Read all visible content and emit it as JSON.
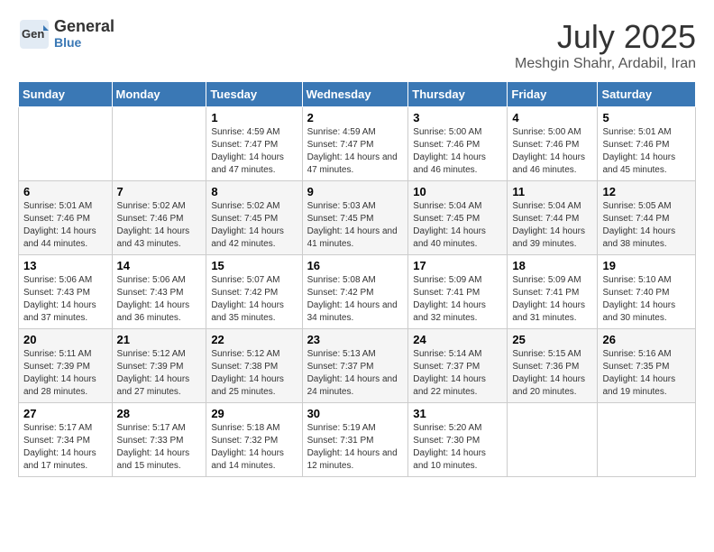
{
  "logo": {
    "general": "General",
    "blue": "Blue"
  },
  "title": {
    "month_year": "July 2025",
    "location": "Meshgin Shahr, Ardabil, Iran"
  },
  "headers": [
    "Sunday",
    "Monday",
    "Tuesday",
    "Wednesday",
    "Thursday",
    "Friday",
    "Saturday"
  ],
  "weeks": [
    [
      {
        "day": "",
        "sunrise": "",
        "sunset": "",
        "daylight": ""
      },
      {
        "day": "",
        "sunrise": "",
        "sunset": "",
        "daylight": ""
      },
      {
        "day": "1",
        "sunrise": "Sunrise: 4:59 AM",
        "sunset": "Sunset: 7:47 PM",
        "daylight": "Daylight: 14 hours and 47 minutes."
      },
      {
        "day": "2",
        "sunrise": "Sunrise: 4:59 AM",
        "sunset": "Sunset: 7:47 PM",
        "daylight": "Daylight: 14 hours and 47 minutes."
      },
      {
        "day": "3",
        "sunrise": "Sunrise: 5:00 AM",
        "sunset": "Sunset: 7:46 PM",
        "daylight": "Daylight: 14 hours and 46 minutes."
      },
      {
        "day": "4",
        "sunrise": "Sunrise: 5:00 AM",
        "sunset": "Sunset: 7:46 PM",
        "daylight": "Daylight: 14 hours and 46 minutes."
      },
      {
        "day": "5",
        "sunrise": "Sunrise: 5:01 AM",
        "sunset": "Sunset: 7:46 PM",
        "daylight": "Daylight: 14 hours and 45 minutes."
      }
    ],
    [
      {
        "day": "6",
        "sunrise": "Sunrise: 5:01 AM",
        "sunset": "Sunset: 7:46 PM",
        "daylight": "Daylight: 14 hours and 44 minutes."
      },
      {
        "day": "7",
        "sunrise": "Sunrise: 5:02 AM",
        "sunset": "Sunset: 7:46 PM",
        "daylight": "Daylight: 14 hours and 43 minutes."
      },
      {
        "day": "8",
        "sunrise": "Sunrise: 5:02 AM",
        "sunset": "Sunset: 7:45 PM",
        "daylight": "Daylight: 14 hours and 42 minutes."
      },
      {
        "day": "9",
        "sunrise": "Sunrise: 5:03 AM",
        "sunset": "Sunset: 7:45 PM",
        "daylight": "Daylight: 14 hours and 41 minutes."
      },
      {
        "day": "10",
        "sunrise": "Sunrise: 5:04 AM",
        "sunset": "Sunset: 7:45 PM",
        "daylight": "Daylight: 14 hours and 40 minutes."
      },
      {
        "day": "11",
        "sunrise": "Sunrise: 5:04 AM",
        "sunset": "Sunset: 7:44 PM",
        "daylight": "Daylight: 14 hours and 39 minutes."
      },
      {
        "day": "12",
        "sunrise": "Sunrise: 5:05 AM",
        "sunset": "Sunset: 7:44 PM",
        "daylight": "Daylight: 14 hours and 38 minutes."
      }
    ],
    [
      {
        "day": "13",
        "sunrise": "Sunrise: 5:06 AM",
        "sunset": "Sunset: 7:43 PM",
        "daylight": "Daylight: 14 hours and 37 minutes."
      },
      {
        "day": "14",
        "sunrise": "Sunrise: 5:06 AM",
        "sunset": "Sunset: 7:43 PM",
        "daylight": "Daylight: 14 hours and 36 minutes."
      },
      {
        "day": "15",
        "sunrise": "Sunrise: 5:07 AM",
        "sunset": "Sunset: 7:42 PM",
        "daylight": "Daylight: 14 hours and 35 minutes."
      },
      {
        "day": "16",
        "sunrise": "Sunrise: 5:08 AM",
        "sunset": "Sunset: 7:42 PM",
        "daylight": "Daylight: 14 hours and 34 minutes."
      },
      {
        "day": "17",
        "sunrise": "Sunrise: 5:09 AM",
        "sunset": "Sunset: 7:41 PM",
        "daylight": "Daylight: 14 hours and 32 minutes."
      },
      {
        "day": "18",
        "sunrise": "Sunrise: 5:09 AM",
        "sunset": "Sunset: 7:41 PM",
        "daylight": "Daylight: 14 hours and 31 minutes."
      },
      {
        "day": "19",
        "sunrise": "Sunrise: 5:10 AM",
        "sunset": "Sunset: 7:40 PM",
        "daylight": "Daylight: 14 hours and 30 minutes."
      }
    ],
    [
      {
        "day": "20",
        "sunrise": "Sunrise: 5:11 AM",
        "sunset": "Sunset: 7:39 PM",
        "daylight": "Daylight: 14 hours and 28 minutes."
      },
      {
        "day": "21",
        "sunrise": "Sunrise: 5:12 AM",
        "sunset": "Sunset: 7:39 PM",
        "daylight": "Daylight: 14 hours and 27 minutes."
      },
      {
        "day": "22",
        "sunrise": "Sunrise: 5:12 AM",
        "sunset": "Sunset: 7:38 PM",
        "daylight": "Daylight: 14 hours and 25 minutes."
      },
      {
        "day": "23",
        "sunrise": "Sunrise: 5:13 AM",
        "sunset": "Sunset: 7:37 PM",
        "daylight": "Daylight: 14 hours and 24 minutes."
      },
      {
        "day": "24",
        "sunrise": "Sunrise: 5:14 AM",
        "sunset": "Sunset: 7:37 PM",
        "daylight": "Daylight: 14 hours and 22 minutes."
      },
      {
        "day": "25",
        "sunrise": "Sunrise: 5:15 AM",
        "sunset": "Sunset: 7:36 PM",
        "daylight": "Daylight: 14 hours and 20 minutes."
      },
      {
        "day": "26",
        "sunrise": "Sunrise: 5:16 AM",
        "sunset": "Sunset: 7:35 PM",
        "daylight": "Daylight: 14 hours and 19 minutes."
      }
    ],
    [
      {
        "day": "27",
        "sunrise": "Sunrise: 5:17 AM",
        "sunset": "Sunset: 7:34 PM",
        "daylight": "Daylight: 14 hours and 17 minutes."
      },
      {
        "day": "28",
        "sunrise": "Sunrise: 5:17 AM",
        "sunset": "Sunset: 7:33 PM",
        "daylight": "Daylight: 14 hours and 15 minutes."
      },
      {
        "day": "29",
        "sunrise": "Sunrise: 5:18 AM",
        "sunset": "Sunset: 7:32 PM",
        "daylight": "Daylight: 14 hours and 14 minutes."
      },
      {
        "day": "30",
        "sunrise": "Sunrise: 5:19 AM",
        "sunset": "Sunset: 7:31 PM",
        "daylight": "Daylight: 14 hours and 12 minutes."
      },
      {
        "day": "31",
        "sunrise": "Sunrise: 5:20 AM",
        "sunset": "Sunset: 7:30 PM",
        "daylight": "Daylight: 14 hours and 10 minutes."
      },
      {
        "day": "",
        "sunrise": "",
        "sunset": "",
        "daylight": ""
      },
      {
        "day": "",
        "sunrise": "",
        "sunset": "",
        "daylight": ""
      }
    ]
  ]
}
